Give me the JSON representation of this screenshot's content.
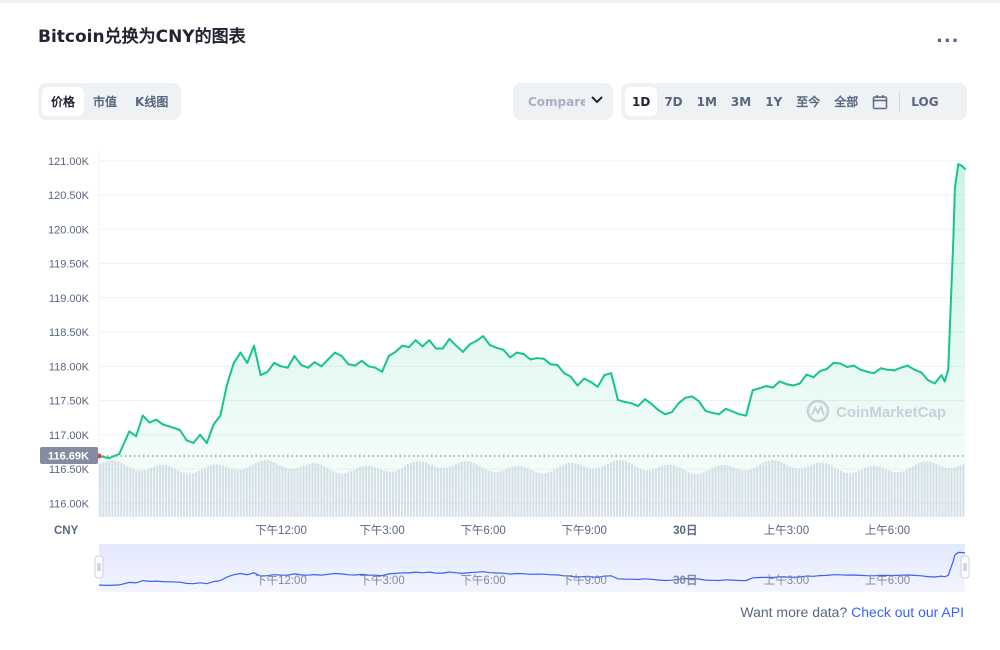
{
  "title": "Bitcoin兑换为CNY的图表",
  "more_label": "...",
  "chart_tabs": [
    "价格",
    "市值",
    "K线图"
  ],
  "compare": {
    "label": "Compare t"
  },
  "range_tabs": [
    "1D",
    "7D",
    "1M",
    "3M",
    "1Y",
    "至今",
    "全部"
  ],
  "range_active": "1D",
  "log_label": "LOG",
  "watermark": "CoinMarketCap",
  "currency_label": "CNY",
  "current_price_label": "116.69K",
  "footer": {
    "text": "Want more data?",
    "link": "Check out our API"
  },
  "colors": {
    "line": "#16c784",
    "accent": "#3861fb",
    "volume": "#cfd6e4",
    "price_tag": "#858ca2"
  },
  "chart_data": {
    "type": "line",
    "title": "Bitcoin兑换为CNY的图表",
    "ylabel": "",
    "xlabel": "",
    "ylim": [
      115800,
      121230
    ],
    "y_ticks": [
      "116.00K",
      "116.50K",
      "117.00K",
      "117.50K",
      "118.00K",
      "118.50K",
      "119.00K",
      "119.50K",
      "120.00K",
      "120.50K",
      "121.00K"
    ],
    "y_tick_values": [
      116000,
      116500,
      117000,
      117500,
      118000,
      118500,
      119000,
      119500,
      120000,
      120500,
      121000
    ],
    "x_ticks": [
      "下午12:00",
      "下午3:00",
      "下午6:00",
      "下午9:00",
      "30日",
      "上午3:00",
      "上午6:00"
    ],
    "x_tick_hours": [
      3,
      6,
      9,
      12,
      15,
      18,
      21
    ],
    "x_domain_hours": [
      -2.4,
      23.3
    ],
    "reference_price": 116690,
    "grid": true,
    "series": [
      {
        "x": [
          -2.4,
          -2.1,
          -1.8,
          -1.5,
          -1.3,
          -1.1,
          -0.9,
          -0.7,
          -0.5,
          -0.3,
          0.0,
          0.2,
          0.4,
          0.6,
          0.8,
          1.0,
          1.2,
          1.4,
          1.6,
          1.8,
          2.0,
          2.2,
          2.4,
          2.6,
          2.8,
          3.0,
          3.2,
          3.4,
          3.6,
          3.8,
          4.0,
          4.2,
          4.4,
          4.6,
          4.8,
          5.0,
          5.2,
          5.4,
          5.6,
          5.8,
          6.0,
          6.2,
          6.4,
          6.6,
          6.8,
          7.0,
          7.2,
          7.4,
          7.6,
          7.8,
          8.0,
          8.2,
          8.4,
          8.6,
          8.8,
          9.0,
          9.2,
          9.4,
          9.6,
          9.8,
          10.0,
          10.2,
          10.4,
          10.6,
          10.8,
          11.0,
          11.2,
          11.4,
          11.6,
          11.8,
          12.0,
          12.2,
          12.4,
          12.6,
          12.8,
          13.0,
          13.2,
          13.4,
          13.6,
          13.8,
          14.0,
          14.2,
          14.4,
          14.6,
          14.8,
          15.0,
          15.2,
          15.4,
          15.6,
          15.8,
          16.0,
          16.2,
          16.4,
          16.6,
          16.8,
          17.0,
          17.2,
          17.4,
          17.6,
          17.8,
          18.0,
          18.2,
          18.4,
          18.6,
          18.8,
          19.0,
          19.2,
          19.4,
          19.6,
          19.8,
          20.0,
          20.2,
          20.4,
          20.6,
          20.8,
          21.0,
          21.2,
          21.4,
          21.6,
          21.8,
          22.0,
          22.2,
          22.4,
          22.6,
          22.7,
          22.8,
          22.95,
          23.0,
          23.1,
          23.2,
          23.3
        ],
        "y": [
          116690,
          116660,
          116720,
          117050,
          116980,
          117280,
          117180,
          117220,
          117150,
          117120,
          117070,
          116920,
          116880,
          117000,
          116880,
          117150,
          117280,
          117730,
          118050,
          118200,
          118050,
          118300,
          117870,
          117920,
          118050,
          118000,
          117980,
          118150,
          118020,
          117980,
          118060,
          118000,
          118100,
          118200,
          118150,
          118030,
          118010,
          118080,
          118000,
          117980,
          117920,
          118150,
          118210,
          118300,
          118280,
          118380,
          118290,
          118380,
          118260,
          118260,
          118400,
          118300,
          118210,
          118320,
          118370,
          118440,
          118310,
          118270,
          118240,
          118130,
          118200,
          118180,
          118100,
          118120,
          118110,
          118030,
          118020,
          117900,
          117850,
          117720,
          117820,
          117770,
          117700,
          117870,
          117900,
          117510,
          117480,
          117460,
          117420,
          117520,
          117450,
          117360,
          117300,
          117330,
          117460,
          117540,
          117560,
          117490,
          117350,
          117320,
          117300,
          117380,
          117340,
          117300,
          117280,
          117650,
          117680,
          117710,
          117690,
          117780,
          117740,
          117720,
          117750,
          117880,
          117840,
          117930,
          117960,
          118050,
          118040,
          117990,
          118010,
          117950,
          117920,
          117900,
          117970,
          117950,
          117940,
          117980,
          118010,
          117950,
          117910,
          117800,
          117750,
          117870,
          117780,
          117950,
          119800,
          120600,
          120950,
          120930,
          120880
        ]
      }
    ]
  }
}
